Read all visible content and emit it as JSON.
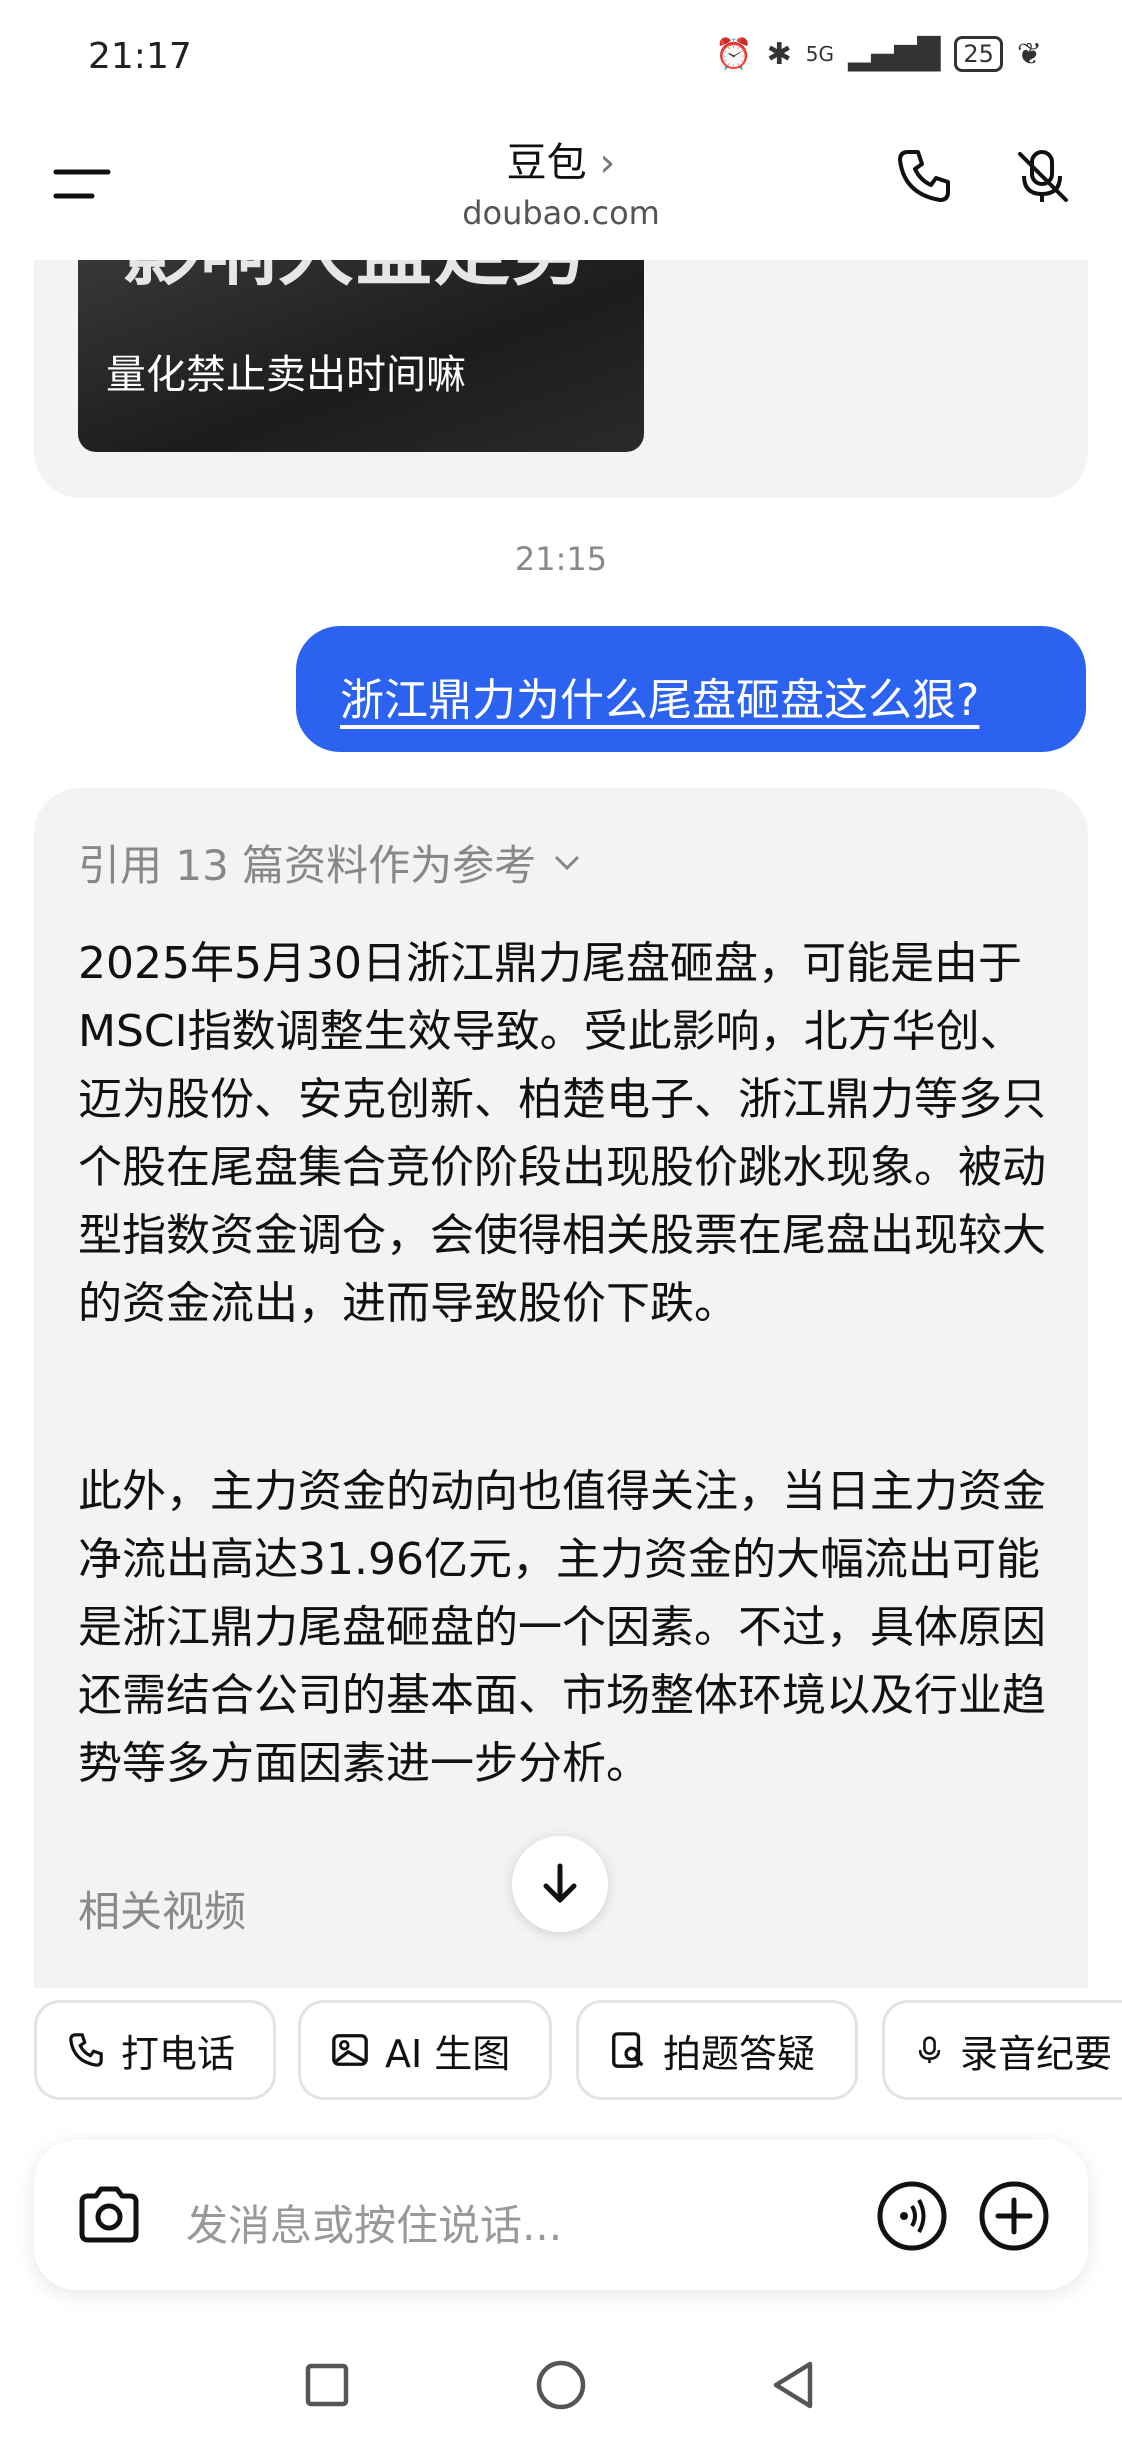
{
  "status": {
    "time": "21:17",
    "network": "5G",
    "battery": "25"
  },
  "header": {
    "title": "豆包",
    "subtitle": "doubao.com"
  },
  "thumbnail": {
    "title": "影响大盘走势",
    "caption": "量化禁止卖出时间嘛"
  },
  "chat": {
    "timestamp": "21:15",
    "user_message": "浙江鼎力为什么尾盘砸盘这么狠?",
    "ref_text": "引用 13 篇资料作为参考",
    "paragraph1": "2025年5月30日浙江鼎力尾盘砸盘，可能是由于MSCI指数调整生效导致。受此影响，北方华创、迈为股份、安克创新、柏楚电子、浙江鼎力等多只个股在尾盘集合竞价阶段出现股价跳水现象。被动型指数资金调仓，会使得相关股票在尾盘出现较大的资金流出，进而导致股价下跌。",
    "paragraph2": "此外，主力资金的动向也值得关注，当日主力资金净流出高达31.96亿元，主力资金的大幅流出可能是浙江鼎力尾盘砸盘的一个因素。不过，具体原因还需结合公司的基本面、市场整体环境以及行业趋势等多方面因素进一步分析。",
    "related_label": "相关视频"
  },
  "quick_actions": [
    "打电话",
    "AI 生图",
    "拍题答疑",
    "录音纪要"
  ],
  "input": {
    "placeholder": "发消息或按住说话..."
  }
}
